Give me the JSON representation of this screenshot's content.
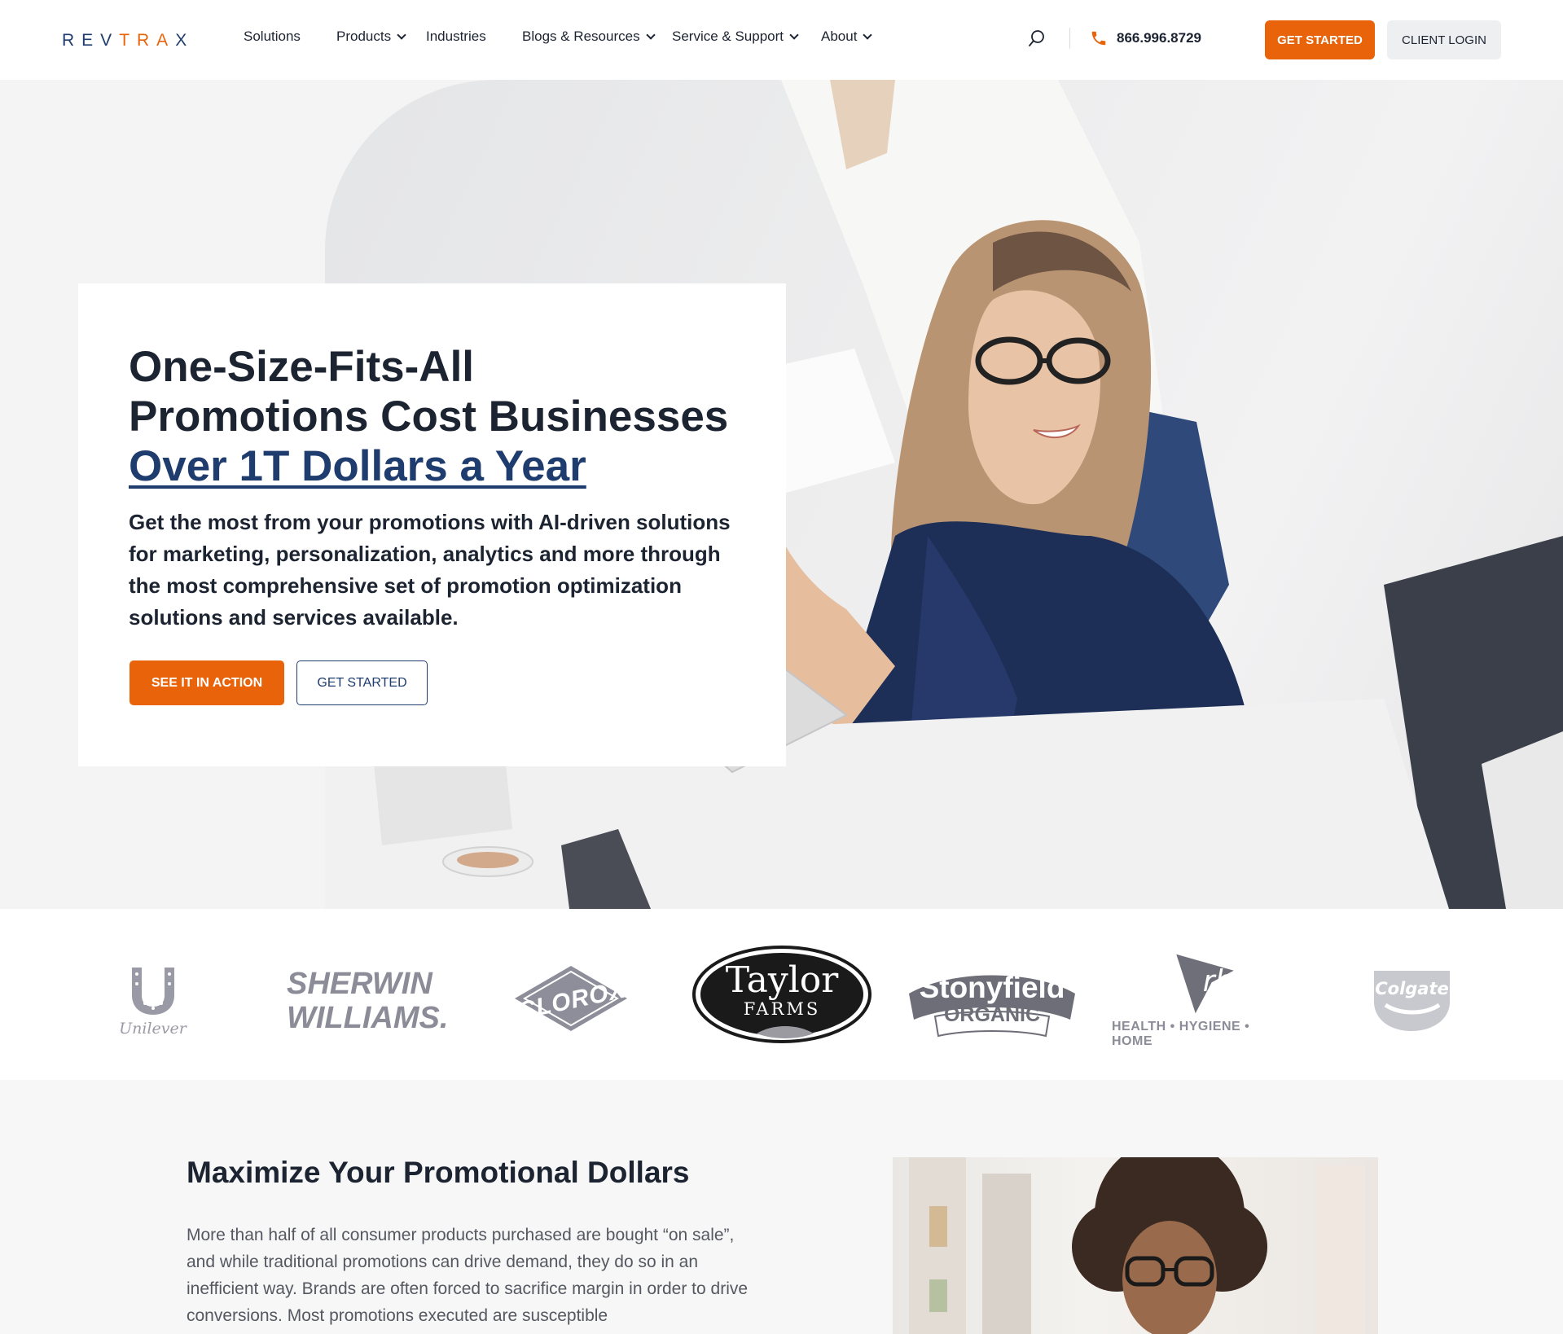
{
  "header": {
    "logo_text": "REVTRAX",
    "nav": [
      {
        "label": "Solutions",
        "has_dropdown": false
      },
      {
        "label": "Products",
        "has_dropdown": true
      },
      {
        "label": "Industries",
        "has_dropdown": false
      },
      {
        "label": "Blogs & Resources",
        "has_dropdown": true
      },
      {
        "label": "Service & Support",
        "has_dropdown": true
      },
      {
        "label": "About",
        "has_dropdown": true
      }
    ],
    "phone": "866.996.8729",
    "get_started_label": "GET STARTED",
    "client_login_label": "CLIENT LOGIN",
    "icons": {
      "search": "search-icon",
      "phone": "phone-icon"
    }
  },
  "hero": {
    "title_line1": "One-Size-Fits-All",
    "title_line2": "Promotions Cost Businesses",
    "title_highlight": "Over 1T Dollars a Year",
    "subtitle": "Get the most from your promotions with AI-driven solutions for marketing, personalization, analytics and more through the most comprehensive set of promotion optimization solutions and services available.",
    "primary_button": "SEE IT IN ACTION",
    "secondary_button": "GET STARTED"
  },
  "brands": [
    {
      "name": "Unilever"
    },
    {
      "name": "Sherwin Williams",
      "line1": "SHERWIN",
      "line2": "WILLIAMS."
    },
    {
      "name": "Clorox",
      "text": "CLOROX"
    },
    {
      "name": "Taylor Farms",
      "line1": "Taylor",
      "line2": "FARMS"
    },
    {
      "name": "Stonyfield Organic",
      "line1": "Stonyfield",
      "line2": "ORGANIC"
    },
    {
      "name": "RB",
      "mark": "rb",
      "tagline": "HEALTH • HYGIENE • HOME"
    },
    {
      "name": "Colgate",
      "text": "Colgate"
    }
  ],
  "section2": {
    "title": "Maximize Your Promotional Dollars",
    "body": "More than half of all consumer products purchased are bought “on sale”, and while traditional promotions can drive demand, they do so in an inefficient way. Brands are often forced to sacrifice margin in order to drive conversions. Most promotions executed are susceptible"
  },
  "colors": {
    "accent": "#e8630a",
    "navy": "#1f3c6e",
    "text": "#1c2331",
    "brand_gray": "#8c8c98"
  }
}
